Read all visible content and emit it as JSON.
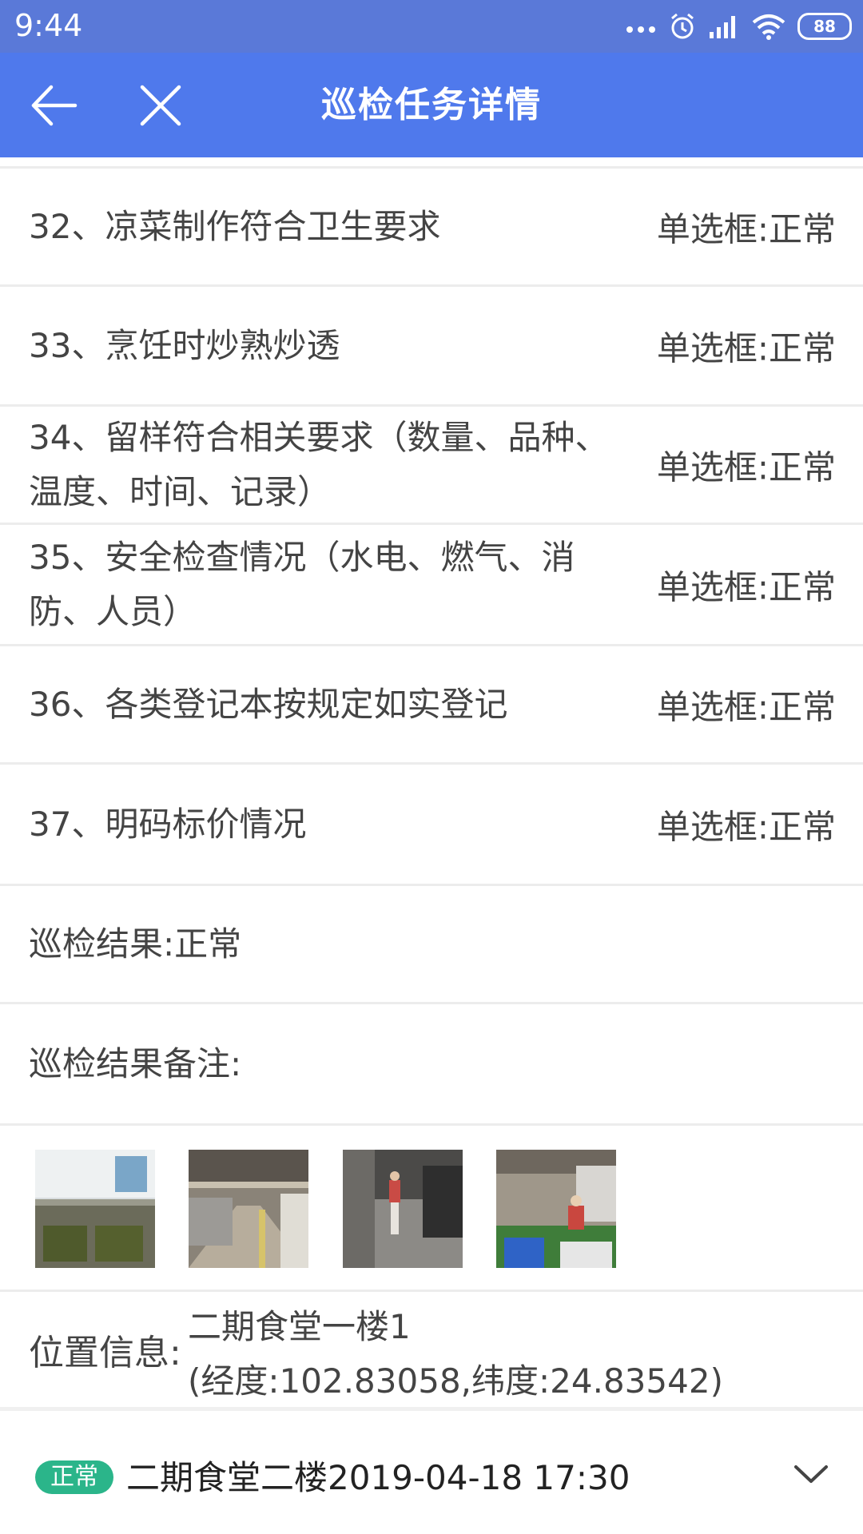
{
  "status_bar": {
    "time": "9:44",
    "battery": "88"
  },
  "app_bar": {
    "title": "巡检任务详情"
  },
  "items": [
    {
      "label": "32、凉菜制作符合卫生要求",
      "value": "单选框:正常"
    },
    {
      "label": "33、烹饪时炒熟炒透",
      "value": "单选框:正常"
    },
    {
      "label": "34、留样符合相关要求（数量、品种、温度、时间、记录）",
      "value": "单选框:正常"
    },
    {
      "label": "35、安全检查情况（水电、燃气、消防、人员）",
      "value": "单选框:正常"
    },
    {
      "label": "36、各类登记本按规定如实登记",
      "value": "单选框:正常"
    },
    {
      "label": "37、明码标价情况",
      "value": "单选框:正常"
    }
  ],
  "result": {
    "label": "巡检结果:正常"
  },
  "result_note": {
    "label": "巡检结果备注:"
  },
  "location": {
    "label": "位置信息:",
    "line1": "二期食堂一楼1",
    "line2": "(经度:102.83058,纬度:24.83542)"
  },
  "footer": {
    "badge": "正常",
    "text": "二期食堂二楼2019-04-18 17:30"
  },
  "colors": {
    "status_bar": "#5a79d8",
    "app_bar": "#4f79ec",
    "badge": "#2bb58a"
  }
}
